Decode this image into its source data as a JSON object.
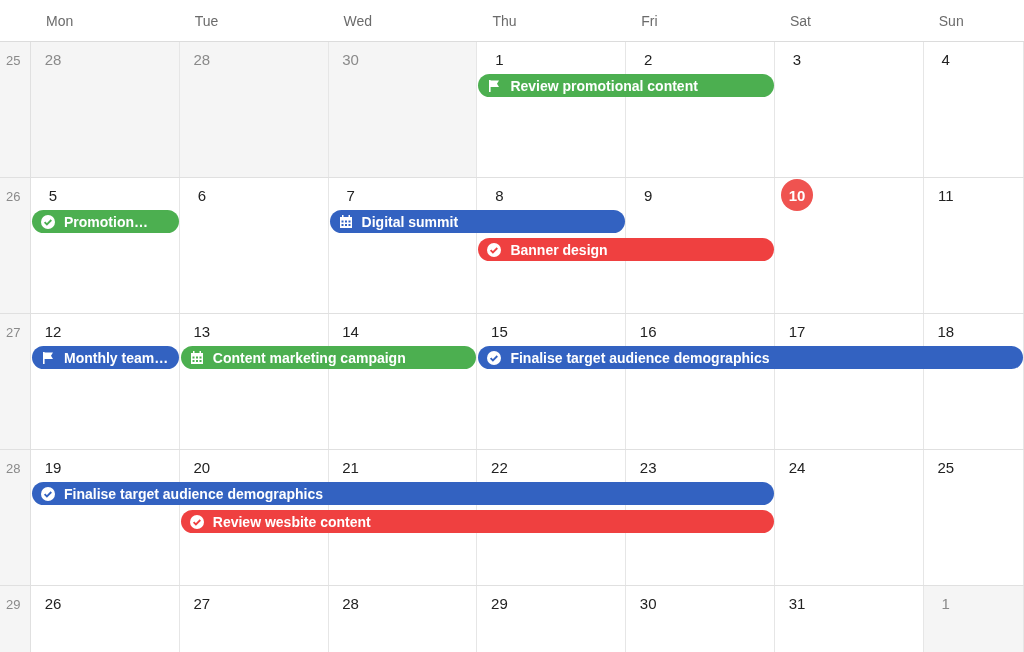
{
  "weekdays": [
    "Mon",
    "Tue",
    "Wed",
    "Thu",
    "Fri",
    "Sat",
    "Sun"
  ],
  "weeks": [
    {
      "number": "25",
      "days": [
        {
          "label": "28",
          "outside": true,
          "today": false
        },
        {
          "label": "28",
          "outside": true,
          "today": false
        },
        {
          "label": "30",
          "outside": true,
          "today": false
        },
        {
          "label": "1",
          "outside": false,
          "today": false
        },
        {
          "label": "2",
          "outside": false,
          "today": false
        },
        {
          "label": "3",
          "outside": false,
          "today": false
        },
        {
          "label": "4",
          "outside": false,
          "today": false
        }
      ],
      "lanes": [
        [
          {
            "kind": "empty"
          },
          {
            "kind": "empty"
          },
          {
            "kind": "empty"
          },
          {
            "kind": "milestone",
            "title": "Review promotional content",
            "color": "#4caf50"
          },
          {
            "kind": "continued"
          },
          {
            "kind": "empty"
          },
          {
            "kind": "empty"
          }
        ]
      ]
    },
    {
      "number": "26",
      "days": [
        {
          "label": "5",
          "outside": false,
          "today": false
        },
        {
          "label": "6",
          "outside": false,
          "today": false
        },
        {
          "label": "7",
          "outside": false,
          "today": false
        },
        {
          "label": "8",
          "outside": false,
          "today": false
        },
        {
          "label": "9",
          "outside": false,
          "today": false
        },
        {
          "label": "10",
          "outside": false,
          "today": true
        },
        {
          "label": "11",
          "outside": false,
          "today": false
        }
      ],
      "lanes": [
        [
          {
            "kind": "task",
            "title": "Promotion…",
            "color": "#4caf50"
          },
          {
            "kind": "empty"
          },
          {
            "kind": "meeting",
            "title": "Digital summit",
            "color": "#3362c1"
          },
          {
            "kind": "continued"
          },
          {
            "kind": "empty"
          },
          {
            "kind": "empty"
          },
          {
            "kind": "empty"
          }
        ],
        [
          {
            "kind": "empty"
          },
          {
            "kind": "empty"
          },
          {
            "kind": "empty"
          },
          {
            "kind": "task",
            "title": "Banner design",
            "color": "#ef4040"
          },
          {
            "kind": "continued"
          },
          {
            "kind": "empty"
          },
          {
            "kind": "empty"
          }
        ]
      ]
    },
    {
      "number": "27",
      "days": [
        {
          "label": "12",
          "outside": false,
          "today": false
        },
        {
          "label": "13",
          "outside": false,
          "today": false
        },
        {
          "label": "14",
          "outside": false,
          "today": false
        },
        {
          "label": "15",
          "outside": false,
          "today": false
        },
        {
          "label": "16",
          "outside": false,
          "today": false
        },
        {
          "label": "17",
          "outside": false,
          "today": false
        },
        {
          "label": "18",
          "outside": false,
          "today": false
        }
      ],
      "lanes": [
        [
          {
            "kind": "milestone",
            "title": "Monthly team…",
            "color": "#3362c1"
          },
          {
            "kind": "meeting",
            "title": "Content marketing campaign",
            "color": "#4caf50"
          },
          {
            "kind": "continued"
          },
          {
            "kind": "task",
            "title": "Finalise target audience demographics",
            "color": "#3362c1"
          },
          {
            "kind": "continued"
          },
          {
            "kind": "continued"
          },
          {
            "kind": "continued"
          }
        ]
      ]
    },
    {
      "number": "28",
      "days": [
        {
          "label": "19",
          "outside": false,
          "today": false
        },
        {
          "label": "20",
          "outside": false,
          "today": false
        },
        {
          "label": "21",
          "outside": false,
          "today": false
        },
        {
          "label": "22",
          "outside": false,
          "today": false
        },
        {
          "label": "23",
          "outside": false,
          "today": false
        },
        {
          "label": "24",
          "outside": false,
          "today": false
        },
        {
          "label": "25",
          "outside": false,
          "today": false
        }
      ],
      "lanes": [
        [
          {
            "kind": "task",
            "title": "Finalise target audience demographics",
            "color": "#3362c1"
          },
          {
            "kind": "continued"
          },
          {
            "kind": "continued"
          },
          {
            "kind": "continued"
          },
          {
            "kind": "continued"
          },
          {
            "kind": "empty"
          },
          {
            "kind": "empty"
          }
        ],
        [
          {
            "kind": "empty"
          },
          {
            "kind": "task",
            "title": "Review wesbite content",
            "color": "#ef4040"
          },
          {
            "kind": "continued"
          },
          {
            "kind": "continued"
          },
          {
            "kind": "continued"
          },
          {
            "kind": "empty"
          },
          {
            "kind": "empty"
          }
        ]
      ]
    },
    {
      "number": "29",
      "days": [
        {
          "label": "26",
          "outside": false,
          "today": false
        },
        {
          "label": "27",
          "outside": false,
          "today": false
        },
        {
          "label": "28",
          "outside": false,
          "today": false
        },
        {
          "label": "29",
          "outside": false,
          "today": false
        },
        {
          "label": "30",
          "outside": false,
          "today": false
        },
        {
          "label": "31",
          "outside": false,
          "today": false
        },
        {
          "label": "1",
          "outside": true,
          "today": false
        }
      ]
    }
  ]
}
